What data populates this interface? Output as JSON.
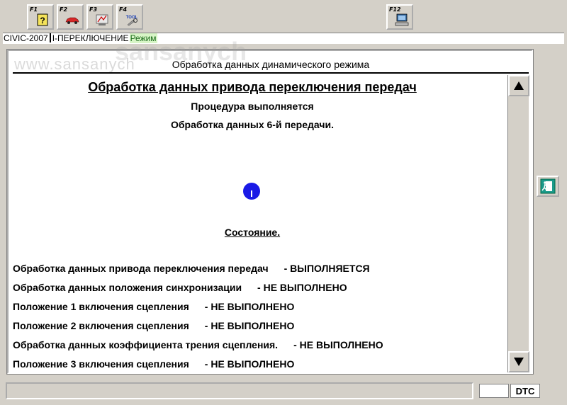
{
  "toolbar": {
    "buttons": [
      {
        "key": "F1",
        "icon": "help-icon"
      },
      {
        "key": "F2",
        "icon": "car-icon"
      },
      {
        "key": "F3",
        "icon": "diagnostic-icon"
      },
      {
        "key": "F4",
        "icon": "tool-icon",
        "label": "TOOL"
      },
      {
        "key": "F12",
        "icon": "computer-icon"
      }
    ]
  },
  "path": {
    "model": "CIVIC-2007",
    "section": "I-ПЕРЕКЛЮЧЕНИЕ",
    "mode": "Режим"
  },
  "watermark": {
    "site": "www.sansanych",
    "name": "sansanych"
  },
  "panel": {
    "header": "Обработка данных динамического режима",
    "title": "Обработка данных привода переключения передач",
    "procedure": "Процедура выполняется",
    "step": "Обработка данных 6-й передачи.",
    "state_title": "Состояние."
  },
  "status": [
    {
      "label": "Обработка данных привода переключения передач",
      "value": "- ВЫПОЛНЯЕТСЯ"
    },
    {
      "label": "Обработка данных положения синхронизации",
      "value": "- НЕ ВЫПОЛНЕНО"
    },
    {
      "label": "Положение 1 включения сцепления",
      "value": "- НЕ ВЫПОЛНЕНО"
    },
    {
      "label": "Положение 2 включения сцепления",
      "value": "- НЕ ВЫПОЛНЕНО"
    },
    {
      "label": "Обработка данных коэффициента трения сцепления.",
      "value": "- НЕ ВЫПОЛНЕНО"
    },
    {
      "label": "Положение 3 включения сцепления",
      "value": "- НЕ ВЫПОЛНЕНО"
    }
  ],
  "statusbar": {
    "dtc": "DTC"
  },
  "colors": {
    "window_bg": "#d4d0c8",
    "progress_dot": "#1a1ae6",
    "mode_bg": "#d7f5c6"
  }
}
